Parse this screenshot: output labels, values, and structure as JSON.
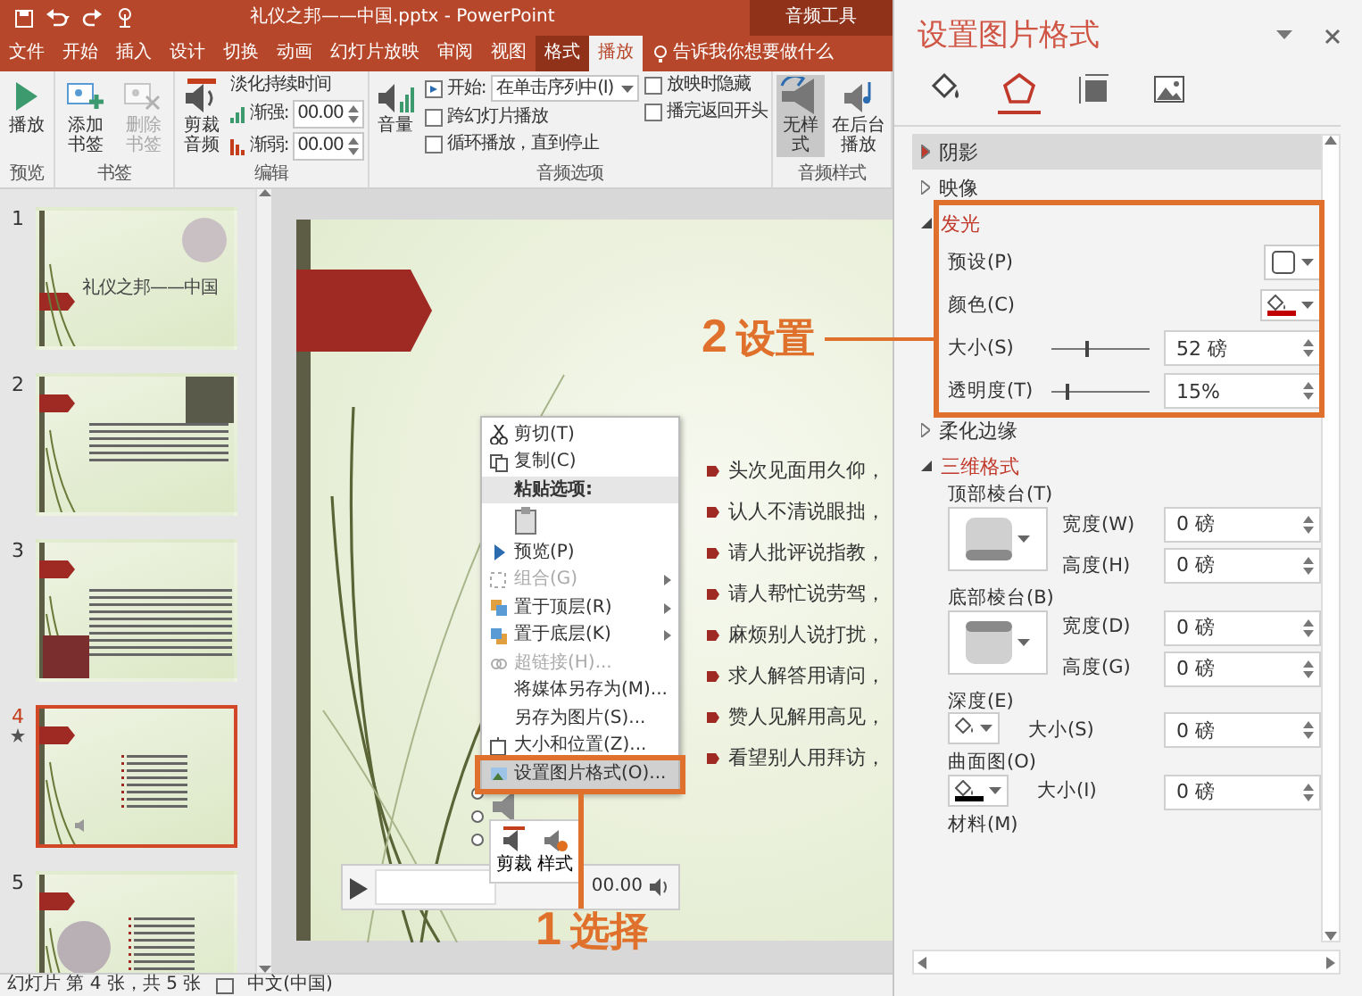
{
  "title_bar": {
    "document_title": "礼仪之邦——中国.pptx - PowerPoint",
    "context_label": "音频工具"
  },
  "ribbon_tabs": [
    {
      "label": "文件",
      "selected": false,
      "contextual": false
    },
    {
      "label": "开始",
      "selected": false,
      "contextual": false
    },
    {
      "label": "插入",
      "selected": false,
      "contextual": false
    },
    {
      "label": "设计",
      "selected": false,
      "contextual": false
    },
    {
      "label": "切换",
      "selected": false,
      "contextual": false
    },
    {
      "label": "动画",
      "selected": false,
      "contextual": false
    },
    {
      "label": "幻灯片放映",
      "selected": false,
      "contextual": false
    },
    {
      "label": "审阅",
      "selected": false,
      "contextual": false
    },
    {
      "label": "视图",
      "selected": false,
      "contextual": false
    },
    {
      "label": "格式",
      "selected": false,
      "contextual": true
    },
    {
      "label": "播放",
      "selected": true,
      "contextual": true
    }
  ],
  "tell_me": "告诉我你想要做什么",
  "ribbon_groups": [
    {
      "label": "预览",
      "controls": [
        {
          "kind": "big",
          "label": "播放",
          "disabled": false,
          "selected": false
        }
      ]
    },
    {
      "label": "书签",
      "controls": [
        {
          "kind": "big",
          "label": "添加书签",
          "disabled": false,
          "selected": false
        },
        {
          "kind": "big",
          "label": "删除书签",
          "disabled": true,
          "selected": false
        }
      ]
    },
    {
      "label": "编辑",
      "controls": [
        {
          "kind": "big",
          "label": "剪裁音频",
          "disabled": false,
          "selected": false
        },
        {
          "kind": "fade",
          "title": "淡化持续时间",
          "fields": [
            {
              "label": "渐强:",
              "value": "00.00"
            },
            {
              "label": "渐弱:",
              "value": "00.00"
            }
          ]
        }
      ]
    },
    {
      "label": "音频选项",
      "controls": [
        {
          "kind": "big",
          "label": "音量",
          "disabled": false,
          "selected": false
        },
        {
          "kind": "stack",
          "items": [
            {
              "kind": "select",
              "label": "开始:",
              "value": "在单击序列中(I)"
            },
            {
              "kind": "checkbox",
              "label": "跨幻灯片播放",
              "checked": false
            },
            {
              "kind": "checkbox",
              "label": "循环播放，直到停止",
              "checked": false
            }
          ]
        },
        {
          "kind": "stack",
          "items": [
            {
              "kind": "checkbox",
              "label": "放映时隐藏",
              "checked": false
            },
            {
              "kind": "checkbox",
              "label": "播完返回开头",
              "checked": false
            }
          ]
        }
      ]
    },
    {
      "label": "音频样式",
      "controls": [
        {
          "kind": "big",
          "label": "无样式",
          "disabled": false,
          "selected": true
        },
        {
          "kind": "big",
          "label": "在后台播放",
          "disabled": false,
          "selected": false
        }
      ]
    }
  ],
  "thumbnails": [
    {
      "number": "1",
      "selected": false,
      "animated": false,
      "kind": "title",
      "title": "礼仪之邦——中国"
    },
    {
      "number": "2",
      "selected": false,
      "animated": false,
      "kind": "text"
    },
    {
      "number": "3",
      "selected": false,
      "animated": false,
      "kind": "text"
    },
    {
      "number": "4",
      "selected": true,
      "animated": true,
      "kind": "list"
    },
    {
      "number": "5",
      "selected": false,
      "animated": false,
      "kind": "list"
    }
  ],
  "slide": {
    "bullets": [
      "头次见面用久仰，",
      "认人不清说眼拙，",
      "请人批评说指教，",
      "请人帮忙说劳驾，",
      "麻烦别人说打扰，",
      "求人解答用请问，",
      "赞人见解用高见，",
      "看望别人用拜访，"
    ],
    "player": {
      "time": "00.00"
    },
    "mini_toolbar": [
      {
        "label": "剪裁"
      },
      {
        "label": "样式"
      }
    ]
  },
  "context_menu": [
    {
      "kind": "item",
      "label": "剪切(T)",
      "disabled": false,
      "submenu": false,
      "selected": false
    },
    {
      "kind": "item",
      "label": "复制(C)",
      "disabled": false,
      "submenu": false,
      "selected": false
    },
    {
      "kind": "header",
      "label": "粘贴选项:"
    },
    {
      "kind": "paste_option"
    },
    {
      "kind": "item",
      "label": "预览(P)",
      "disabled": false,
      "submenu": false,
      "selected": false
    },
    {
      "kind": "item",
      "label": "组合(G)",
      "disabled": true,
      "submenu": true,
      "selected": false
    },
    {
      "kind": "item",
      "label": "置于顶层(R)",
      "disabled": false,
      "submenu": true,
      "selected": false
    },
    {
      "kind": "item",
      "label": "置于底层(K)",
      "disabled": false,
      "submenu": true,
      "selected": false
    },
    {
      "kind": "item",
      "label": "超链接(H)...",
      "disabled": true,
      "submenu": false,
      "selected": false
    },
    {
      "kind": "item",
      "label": "将媒体另存为(M)...",
      "disabled": false,
      "submenu": false,
      "selected": false
    },
    {
      "kind": "item",
      "label": "另存为图片(S)...",
      "disabled": false,
      "submenu": false,
      "selected": false
    },
    {
      "kind": "item",
      "label": "大小和位置(Z)...",
      "disabled": false,
      "submenu": false,
      "selected": false
    },
    {
      "kind": "item",
      "label": "设置图片格式(O)...",
      "disabled": false,
      "submenu": false,
      "selected": true
    }
  ],
  "status_bar": {
    "slide_info": "幻灯片 第 4 张，共 5 张",
    "language": "中文(中国)"
  },
  "format_pane": {
    "title": "设置图片格式",
    "tabs": [
      {
        "selected": false
      },
      {
        "selected": true
      },
      {
        "selected": false
      },
      {
        "selected": false
      }
    ],
    "sections": [
      {
        "title": "阴影",
        "expanded": false,
        "highlighted": true
      },
      {
        "title": "映像",
        "expanded": false,
        "highlighted": false
      },
      {
        "title": "发光",
        "expanded": true,
        "highlighted": false,
        "rows": [
          {
            "kind": "preset",
            "label": "预设(P)"
          },
          {
            "kind": "color",
            "label": "颜色(C)",
            "color": "#c00000"
          },
          {
            "kind": "slider",
            "label": "大小(S)",
            "level": 0.35,
            "value": "52 磅"
          },
          {
            "kind": "slider",
            "label": "透明度(T)",
            "level": 0.15,
            "value": "15%"
          }
        ]
      },
      {
        "title": "柔化边缘",
        "expanded": false,
        "highlighted": false
      },
      {
        "title": "三维格式",
        "expanded": true,
        "highlighted": false,
        "rows": [
          {
            "kind": "bevel",
            "label": "顶部棱台(T)",
            "fields": [
              {
                "label": "宽度(W)",
                "value": "0 磅"
              },
              {
                "label": "高度(H)",
                "value": "0 磅"
              }
            ]
          },
          {
            "kind": "bevel",
            "label": "底部棱台(B)",
            "fields": [
              {
                "label": "宽度(D)",
                "value": "0 磅"
              },
              {
                "label": "高度(G)",
                "value": "0 磅"
              }
            ]
          },
          {
            "kind": "color_size",
            "label": "深度(E)",
            "fields": [
              {
                "label": "大小(S)",
                "value": "0 磅"
              }
            ]
          },
          {
            "kind": "color_size",
            "label": "曲面图(O)",
            "color": "#000000",
            "fields": [
              {
                "label": "大小(I)",
                "value": "0 磅"
              }
            ]
          },
          {
            "kind": "plain",
            "label": "材料(M)"
          }
        ]
      }
    ]
  },
  "annotations": [
    {
      "number": "1",
      "text": "选择"
    },
    {
      "number": "2",
      "text": "设置"
    }
  ]
}
